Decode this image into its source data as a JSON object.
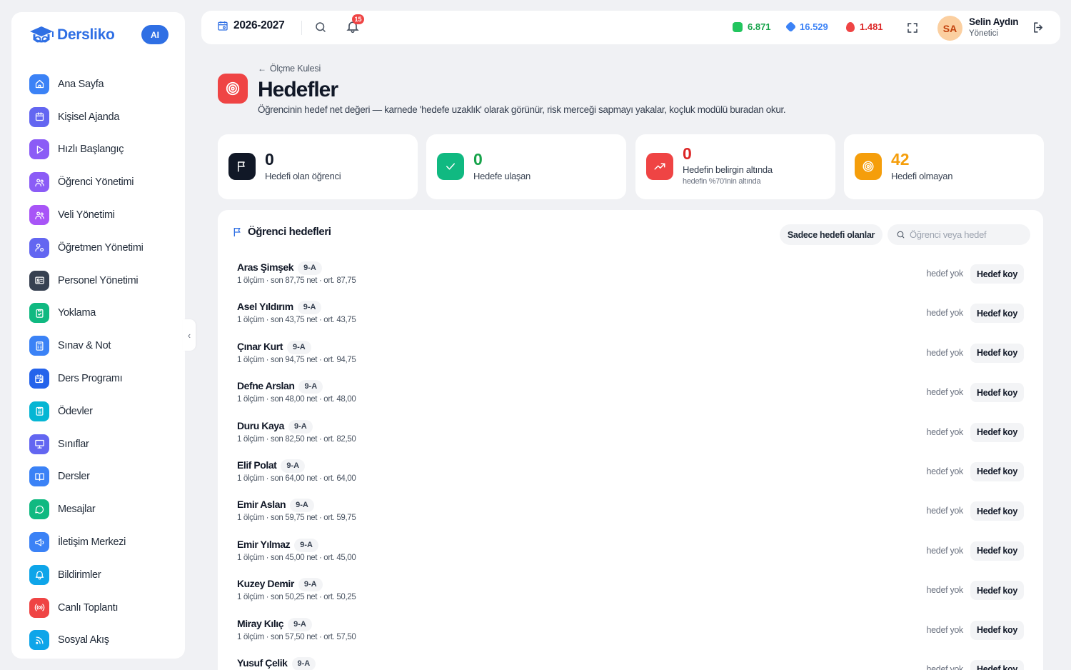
{
  "brand": {
    "name": "Dersliko",
    "ai_label": "AI",
    "color": "#2f6fe4"
  },
  "sidebar": {
    "items": [
      {
        "label": "Ana Sayfa",
        "icon": "home-icon",
        "color": "#3b82f6"
      },
      {
        "label": "Kişisel Ajanda",
        "icon": "calendar-icon",
        "color": "#6366f1"
      },
      {
        "label": "Hızlı Başlangıç",
        "icon": "play-icon",
        "color": "#8b5cf6"
      },
      {
        "label": "Öğrenci Yönetimi",
        "icon": "users-icon",
        "color": "#8b5cf6"
      },
      {
        "label": "Veli Yönetimi",
        "icon": "users-icon",
        "color": "#a855f7"
      },
      {
        "label": "Öğretmen Yönetimi",
        "icon": "user-gear-icon",
        "color": "#6366f1"
      },
      {
        "label": "Personel Yönetimi",
        "icon": "id-card-icon",
        "color": "#374151"
      },
      {
        "label": "Yoklama",
        "icon": "clipboard-check-icon",
        "color": "#10b981"
      },
      {
        "label": "Sınav & Not",
        "icon": "calculator-icon",
        "color": "#3b82f6"
      },
      {
        "label": "Ders Programı",
        "icon": "calendar-clock-icon",
        "color": "#2563eb"
      },
      {
        "label": "Ödevler",
        "icon": "clipboard-list-icon",
        "color": "#06b6d4"
      },
      {
        "label": "Sınıflar",
        "icon": "presentation-icon",
        "color": "#6366f1"
      },
      {
        "label": "Dersler",
        "icon": "book-open-icon",
        "color": "#3b82f6"
      },
      {
        "label": "Mesajlar",
        "icon": "message-icon",
        "color": "#10b981"
      },
      {
        "label": "İletişim Merkezi",
        "icon": "megaphone-icon",
        "color": "#3b82f6"
      },
      {
        "label": "Bildirimler",
        "icon": "bell-icon",
        "color": "#0ea5e9"
      },
      {
        "label": "Canlı Toplantı",
        "icon": "broadcast-icon",
        "color": "#ef4444"
      },
      {
        "label": "Sosyal Akış",
        "icon": "rss-icon",
        "color": "#0ea5e9"
      }
    ]
  },
  "topbar": {
    "year": "2026-2027",
    "notification_count": "15",
    "stats": [
      {
        "value": "6.871",
        "color": "#16a34a",
        "icon": "gem-green-icon"
      },
      {
        "value": "16.529",
        "color": "#3b82f6",
        "icon": "gem-blue-icon"
      },
      {
        "value": "1.481",
        "color": "#dc2626",
        "icon": "flame-icon"
      }
    ],
    "user": {
      "initials": "SA",
      "name": "Selin Aydın",
      "role": "Yönetici"
    }
  },
  "header": {
    "breadcrumb": "Ölçme Kulesi",
    "title": "Hedefler",
    "description": "Öğrencinin hedef net değeri — karnede 'hedefe uzaklık' olarak görünür, risk merceği sapmayı yakalar, koçluk modülü buradan okur."
  },
  "cards": [
    {
      "value": "0",
      "label": "Hedefi olan öğrenci",
      "sub": "",
      "color": "#111827",
      "icon": "flag-icon"
    },
    {
      "value": "0",
      "label": "Hedefe ulaşan",
      "sub": "",
      "color": "#16a34a",
      "icon": "check-icon"
    },
    {
      "value": "0",
      "label": "Hedefin belirgin altında",
      "sub": "hedefin %70'inin altında",
      "color": "#dc2626",
      "icon": "trend-up-icon"
    },
    {
      "value": "42",
      "label": "Hedefi olmayan",
      "sub": "",
      "color": "#f59e0b",
      "icon": "target-icon"
    }
  ],
  "panel": {
    "title": "Öğrenci hedefleri",
    "filter_label": "Sadece hedefi olanlar",
    "search_placeholder": "Öğrenci veya hedef",
    "status_text": "hedef yok",
    "action_label": "Hedef koy",
    "rows": [
      {
        "name": "Aras Şimşek",
        "class": "9-A",
        "meta": "1 ölçüm · son 87,75 net · ort. 87,75"
      },
      {
        "name": "Asel Yıldırım",
        "class": "9-A",
        "meta": "1 ölçüm · son 43,75 net · ort. 43,75"
      },
      {
        "name": "Çınar Kurt",
        "class": "9-A",
        "meta": "1 ölçüm · son 94,75 net · ort. 94,75"
      },
      {
        "name": "Defne Arslan",
        "class": "9-A",
        "meta": "1 ölçüm · son 48,00 net · ort. 48,00"
      },
      {
        "name": "Duru Kaya",
        "class": "9-A",
        "meta": "1 ölçüm · son 82,50 net · ort. 82,50"
      },
      {
        "name": "Elif Polat",
        "class": "9-A",
        "meta": "1 ölçüm · son 64,00 net · ort. 64,00"
      },
      {
        "name": "Emir Aslan",
        "class": "9-A",
        "meta": "1 ölçüm · son 59,75 net · ort. 59,75"
      },
      {
        "name": "Emir Yılmaz",
        "class": "9-A",
        "meta": "1 ölçüm · son 45,00 net · ort. 45,00"
      },
      {
        "name": "Kuzey Demir",
        "class": "9-A",
        "meta": "1 ölçüm · son 50,25 net · ort. 50,25"
      },
      {
        "name": "Miray Kılıç",
        "class": "9-A",
        "meta": "1 ölçüm · son 57,50 net · ort. 57,50"
      },
      {
        "name": "Yusuf Çelik",
        "class": "9-A",
        "meta": ""
      }
    ]
  }
}
